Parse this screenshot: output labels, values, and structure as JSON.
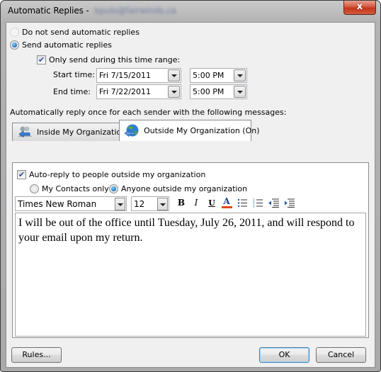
{
  "window": {
    "title": "Automatic Replies -",
    "title_account_redacted": "kpulo@fairwinds.ca",
    "close_label": "x"
  },
  "options": {
    "do_not_send": {
      "label": "Do not send automatic replies",
      "selected": false
    },
    "send": {
      "label": "Send automatic replies",
      "selected": true
    },
    "time_range": {
      "label": "Only send during this time range:",
      "checked": true,
      "check_glyph": "✔"
    },
    "start": {
      "label": "Start time:",
      "date": "Fri 7/15/2011",
      "time": "5:00 PM"
    },
    "end": {
      "label": "End time:",
      "date": "Fri 7/22/2011",
      "time": "5:00 PM"
    }
  },
  "section_label": "Automatically reply once for each sender with the following messages:",
  "tabs": [
    {
      "label": "Inside My Organization",
      "icon": "people-arrow-icon",
      "active": false
    },
    {
      "label": "Outside My Organization (On)",
      "icon": "globe-arrow-icon",
      "active": true
    }
  ],
  "outside_panel": {
    "auto_reply": {
      "label": "Auto-reply to people outside my organization",
      "checked": true,
      "check_glyph": "✔"
    },
    "scope": [
      {
        "label": "My Contacts only",
        "selected": false
      },
      {
        "label": "Anyone outside my organization",
        "selected": true
      }
    ],
    "font_name": "Times New Roman",
    "font_size": "12",
    "toolbar": {
      "bold": "B",
      "italic": "I",
      "underline": "U",
      "font_color": "A",
      "font_color_hex": "#e8461c"
    },
    "message": "I will be out of the office until Tuesday, July 26, 2011, and will respond to your email upon my return."
  },
  "buttons": {
    "rules": "Rules...",
    "ok": "OK",
    "cancel": "Cancel"
  }
}
